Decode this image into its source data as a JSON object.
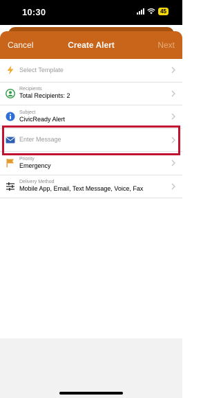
{
  "status_bar": {
    "time": "10:30",
    "battery": "45",
    "battery_color": "#f5d90a"
  },
  "nav": {
    "cancel_label": "Cancel",
    "title": "Create Alert",
    "next_label": "Next",
    "color": "#c8651a"
  },
  "rows": [
    {
      "icon": "lightning-icon",
      "caption": "",
      "value": "",
      "placeholder": "Select Template"
    },
    {
      "icon": "recipients-icon",
      "caption": "Recipients",
      "value": "Total Recipients: 2",
      "placeholder": ""
    },
    {
      "icon": "info-icon",
      "caption": "Subject",
      "value": "CivicReady Alert",
      "placeholder": ""
    },
    {
      "icon": "envelope-icon",
      "caption": "",
      "value": "",
      "placeholder": "Enter Message"
    },
    {
      "icon": "flag-icon",
      "caption": "Priority",
      "value": "Emergency",
      "placeholder": ""
    },
    {
      "icon": "sliders-icon",
      "caption": "Delivery Method",
      "value": "Mobile App, Email, Text Message, Voice, Fax",
      "placeholder": ""
    }
  ],
  "highlight_color": "#c1122f"
}
